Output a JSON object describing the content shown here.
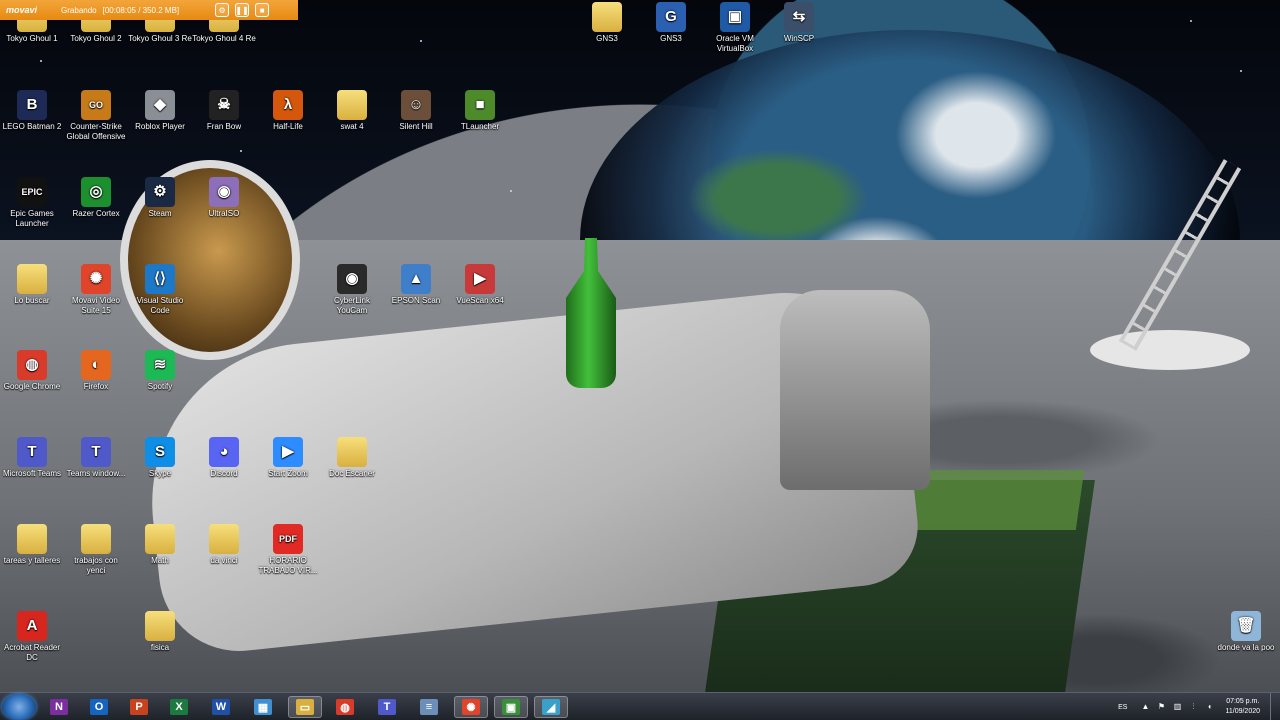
{
  "recorder": {
    "brand": "movavi",
    "status": "Grabando",
    "timer": "[00:08:05 / 350.2 MB]",
    "buttons": [
      {
        "name": "settings-icon",
        "glyph": "⚙"
      },
      {
        "name": "pause-icon",
        "glyph": "❚❚"
      },
      {
        "name": "stop-icon",
        "glyph": "■"
      }
    ]
  },
  "desktop_icons": [
    {
      "id": "tokyo-ghoul-1",
      "label": "Tokyo Ghoul 1",
      "glyph": "",
      "color": "#d9b040"
    },
    {
      "id": "tokyo-ghoul-2",
      "label": "Tokyo Ghoul 2",
      "glyph": "",
      "color": "#d9b040"
    },
    {
      "id": "tokyo-ghoul-3-re",
      "label": "Tokyo Ghoul 3 Re",
      "glyph": "",
      "color": "#d9b040"
    },
    {
      "id": "tokyo-ghoul-4-re",
      "label": "Tokyo Ghoul 4 Re",
      "glyph": "",
      "color": "#d9b040"
    },
    {
      "id": "gns3-folder",
      "label": "GNS3",
      "glyph": "",
      "color": "#d9b040"
    },
    {
      "id": "gns3-app",
      "label": "GNS3",
      "glyph": "G",
      "color": "#2b5fb0"
    },
    {
      "id": "oracle-vm-virtualbox",
      "label": "Oracle VM VirtualBox",
      "glyph": "▣",
      "color": "#1f5aa6"
    },
    {
      "id": "winscp",
      "label": "WinSCP",
      "glyph": "⇆",
      "color": "#3b4f6b"
    },
    {
      "id": "lego-batman-2",
      "label": "LEGO Batman 2",
      "glyph": "B",
      "color": "#1c2a55"
    },
    {
      "id": "counter-strike-go",
      "label": "Counter-Strike Global Offensive",
      "glyph": "GO",
      "color": "#c77a18"
    },
    {
      "id": "roblox-player",
      "label": "Roblox Player",
      "glyph": "◆",
      "color": "#8a8f96"
    },
    {
      "id": "fran-bow",
      "label": "Fran Bow",
      "glyph": "☠",
      "color": "#222222"
    },
    {
      "id": "half-life",
      "label": "Half-Life",
      "glyph": "λ",
      "color": "#d4570b"
    },
    {
      "id": "swat-4",
      "label": "swat 4",
      "glyph": "",
      "color": "#d9b040"
    },
    {
      "id": "silent-hill",
      "label": "Silent Hill",
      "glyph": "☺",
      "color": "#6b4f3a"
    },
    {
      "id": "tlauncher",
      "label": "TLauncher",
      "glyph": "■",
      "color": "#4c8a2a"
    },
    {
      "id": "epic-games-launcher",
      "label": "Epic Games Launcher",
      "glyph": "EPIC",
      "color": "#111111"
    },
    {
      "id": "razer-cortex",
      "label": "Razer Cortex",
      "glyph": "◎",
      "color": "#1c8f2e"
    },
    {
      "id": "steam",
      "label": "Steam",
      "glyph": "⚙",
      "color": "#1b2a44"
    },
    {
      "id": "ultraiso",
      "label": "UltraISO",
      "glyph": "◉",
      "color": "#8c6fb8"
    },
    {
      "id": "lo-buscar",
      "label": "Lo buscar",
      "glyph": "",
      "color": "#d9b040"
    },
    {
      "id": "movavi-video-suite",
      "label": "Movavi Video Suite 15",
      "glyph": "✺",
      "color": "#e0452b"
    },
    {
      "id": "visual-studio-code",
      "label": "Visual Studio Code",
      "glyph": "⟨⟩",
      "color": "#1e78c8"
    },
    {
      "id": "cyberlink-youcam",
      "label": "CyberLink YouCam",
      "glyph": "◉",
      "color": "#2a2a2a"
    },
    {
      "id": "epson-scan",
      "label": "EPSON Scan",
      "glyph": "▲",
      "color": "#3f7fc9"
    },
    {
      "id": "vuescan",
      "label": "VueScan x64",
      "glyph": "▶",
      "color": "#c83a3a"
    },
    {
      "id": "google-chrome",
      "label": "Google Chrome",
      "glyph": "◍",
      "color": "#d93b2b"
    },
    {
      "id": "firefox",
      "label": "Firefox",
      "glyph": "◐",
      "color": "#e4661f"
    },
    {
      "id": "spotify",
      "label": "Spotify",
      "glyph": "≋",
      "color": "#1db954"
    },
    {
      "id": "microsoft-teams",
      "label": "Microsoft Teams",
      "glyph": "T",
      "color": "#5059c9"
    },
    {
      "id": "teams-windows",
      "label": "Teams window...",
      "glyph": "T",
      "color": "#5059c9"
    },
    {
      "id": "skype",
      "label": "Skype",
      "glyph": "S",
      "color": "#0f8ee8"
    },
    {
      "id": "discord",
      "label": "Discord",
      "glyph": "◕",
      "color": "#5865f2"
    },
    {
      "id": "start-zoom",
      "label": "Start Zoom",
      "glyph": "▶",
      "color": "#2d8cff"
    },
    {
      "id": "doc-escaner",
      "label": "Doc Escaner",
      "glyph": "",
      "color": "#d9b040"
    },
    {
      "id": "tareas-y-talleres",
      "label": "tareas y talleres",
      "glyph": "",
      "color": "#d9b040"
    },
    {
      "id": "trabajos-con-yenci",
      "label": "trabajos con yenci",
      "glyph": "",
      "color": "#d9b040"
    },
    {
      "id": "math",
      "label": "Math",
      "glyph": "",
      "color": "#d9b040"
    },
    {
      "id": "da-vinci",
      "label": "da vinci",
      "glyph": "",
      "color": "#d9b040"
    },
    {
      "id": "horario-trabajo",
      "label": "HORARIO TRABAJO VIR...",
      "glyph": "PDF",
      "color": "#e02a23"
    },
    {
      "id": "acrobat-reader-dc",
      "label": "Acrobat Reader DC",
      "glyph": "A",
      "color": "#d7261e"
    },
    {
      "id": "fisica",
      "label": "fisica",
      "glyph": "",
      "color": "#d9b040"
    },
    {
      "id": "donde-va-la-popo",
      "label": "donde va la poo",
      "glyph": "🗑",
      "color": "#8fb6d8"
    }
  ],
  "taskbar": {
    "apps": [
      {
        "id": "onenote",
        "glyph": "N",
        "color": "#7b2f9e"
      },
      {
        "id": "outlook",
        "glyph": "O",
        "color": "#1565c0"
      },
      {
        "id": "powerpoint",
        "glyph": "P",
        "color": "#c8421d"
      },
      {
        "id": "excel",
        "glyph": "X",
        "color": "#1d7a3f"
      },
      {
        "id": "word",
        "glyph": "W",
        "color": "#1f4fa6"
      },
      {
        "id": "control-panel",
        "glyph": "▦",
        "color": "#3f8fd1"
      },
      {
        "id": "file-explorer",
        "glyph": "▭",
        "color": "#d9b040"
      },
      {
        "id": "chrome",
        "glyph": "◍",
        "color": "#d93b2b"
      },
      {
        "id": "teams",
        "glyph": "T",
        "color": "#5059c9"
      },
      {
        "id": "notepad",
        "glyph": "≡",
        "color": "#6b8fb8"
      },
      {
        "id": "movavi",
        "glyph": "✺",
        "color": "#e0452b"
      },
      {
        "id": "media",
        "glyph": "▣",
        "color": "#3a8f3a"
      },
      {
        "id": "app-window",
        "glyph": "◢",
        "color": "#3aa0c8"
      }
    ],
    "tray": {
      "lang": "ES",
      "icons": [
        "▲",
        "⚑",
        "▥",
        "⫶",
        "◖"
      ],
      "time": "07:05 p.m.",
      "date": "11/09/2020"
    }
  }
}
